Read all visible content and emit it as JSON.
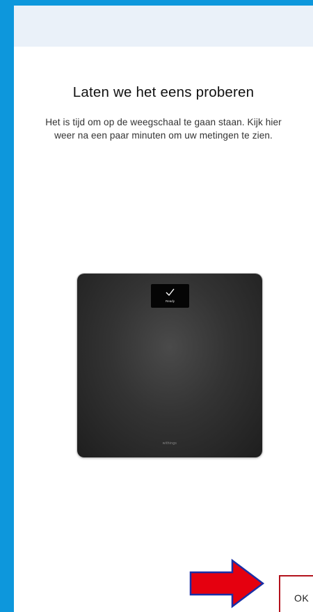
{
  "page": {
    "title": "Laten we het eens proberen",
    "description": "Het is tijd om op de weegschaal te gaan staan. Kijk hier weer na een paar minuten om uw metingen te zien."
  },
  "scale_image": {
    "display_text": "Ready",
    "display_icon": "checkmark-icon",
    "brand": "withings"
  },
  "actions": {
    "ok_label": "OK"
  },
  "annotation": {
    "icon": "red-arrow-right-icon",
    "color": "#e5000f",
    "outline_color": "#1a2fa6",
    "highlight_color": "#b3121c"
  },
  "colors": {
    "frame": "#0d97dc",
    "header": "#eaf1f9",
    "background": "#ffffff"
  }
}
